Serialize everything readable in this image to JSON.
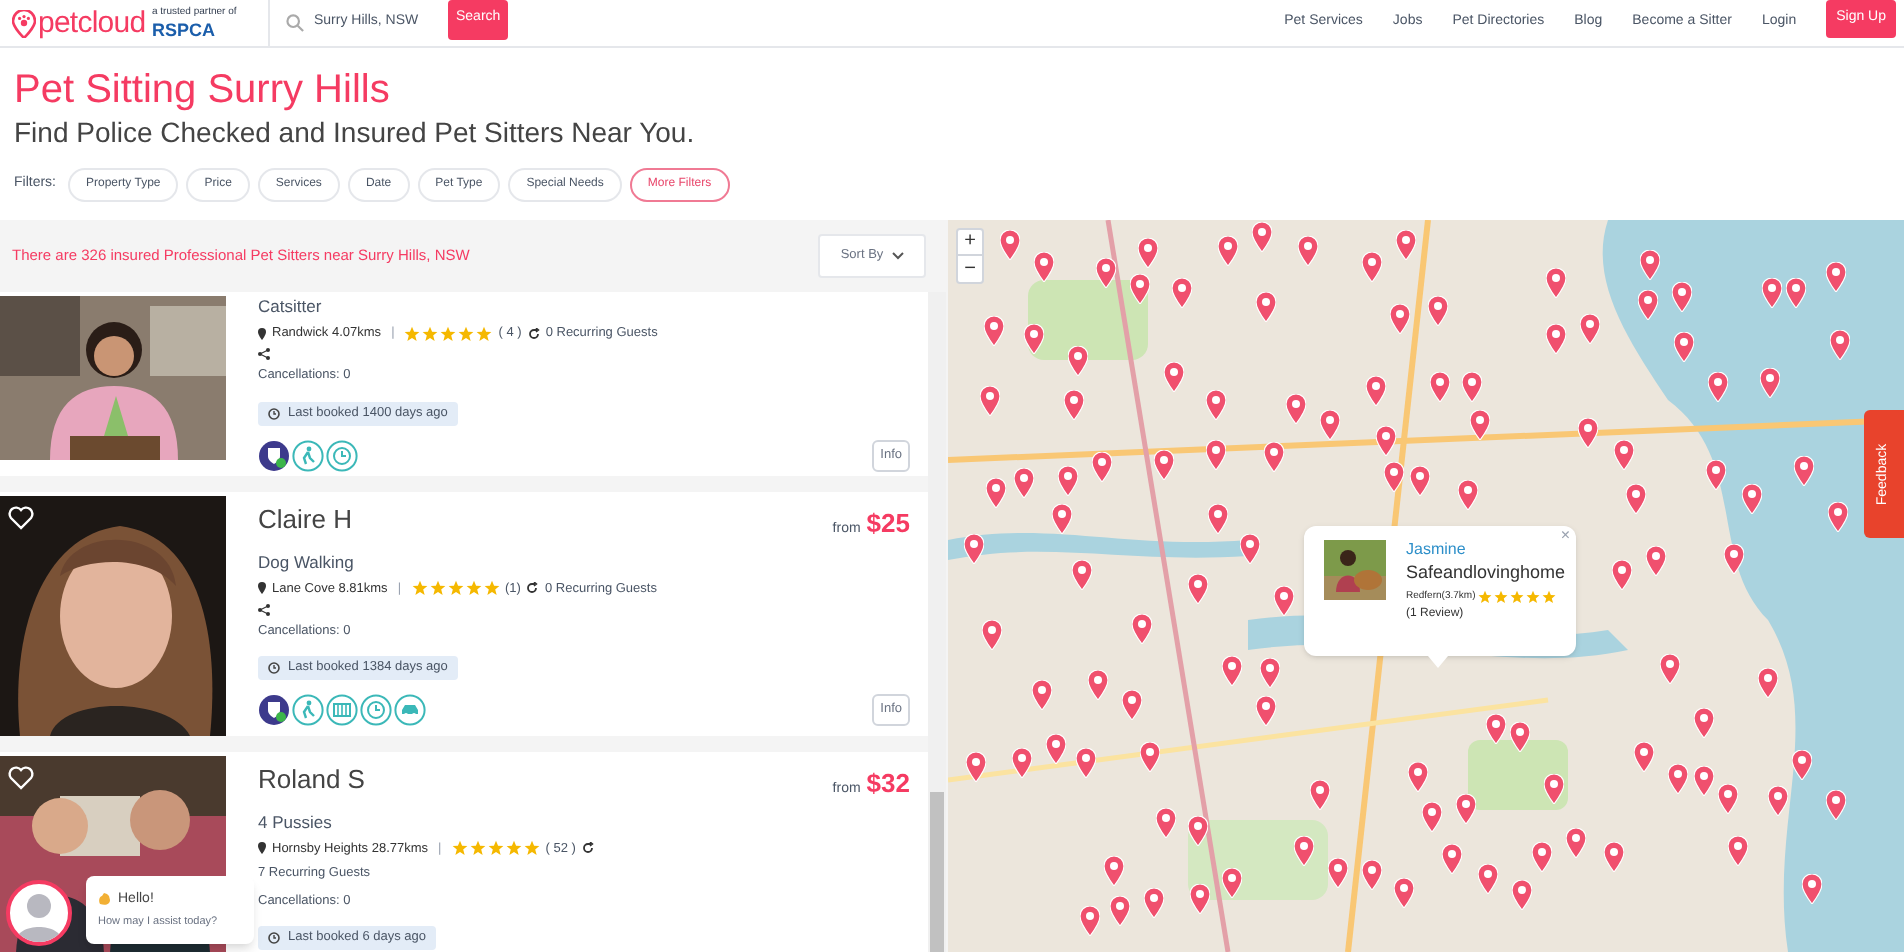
{
  "header": {
    "logo": "petcloud",
    "partner_text": "a trusted partner of",
    "partner": "RSPCA",
    "search": {
      "value": "Surry Hills, NSW"
    },
    "search_button": "Search",
    "nav": [
      "Pet Services",
      "Jobs",
      "Pet Directories",
      "Blog",
      "Become a Sitter",
      "Login"
    ],
    "sign_up": "Sign Up"
  },
  "title": "Pet Sitting Surry Hills",
  "subtitle": "Find Police Checked and Insured Pet Sitters Near You.",
  "filters": {
    "label": "Filters:",
    "items": [
      {
        "label": "Property Type",
        "highlighted": false
      },
      {
        "label": "Price",
        "highlighted": false
      },
      {
        "label": "Services",
        "highlighted": false
      },
      {
        "label": "Date",
        "highlighted": false
      },
      {
        "label": "Pet Type",
        "highlighted": false
      },
      {
        "label": "Special Needs",
        "highlighted": false
      },
      {
        "label": "More Filters",
        "highlighted": true
      }
    ]
  },
  "results": {
    "summary": "There are 326 insured Professional Pet Sitters near Surry Hills, NSW",
    "sort": "Sort By"
  },
  "sitters": [
    {
      "service": "Catsitter",
      "location": "Randwick 4.07kms",
      "separator": "|",
      "stars": 5,
      "reviews": "( 4 )",
      "recurring": "0 Recurring Guests",
      "cancellations": "Cancellations: 0",
      "last_booked": "Last booked 1400 days ago",
      "badges": [
        {
          "kind": "police_check"
        },
        {
          "kind": "walking"
        },
        {
          "kind": "clock"
        }
      ],
      "info": "Info"
    },
    {
      "name": "Claire H",
      "favorite": false,
      "price_from": "from",
      "price": "$25",
      "service": "Dog Walking",
      "location": "Lane Cove 8.81kms",
      "separator": "|",
      "stars": 5,
      "reviews": "(1)",
      "recurring": "0 Recurring Guests",
      "cancellations": "Cancellations: 0",
      "last_booked": "Last booked 1384 days ago",
      "badges": [
        {
          "kind": "police_check"
        },
        {
          "kind": "walking"
        },
        {
          "kind": "kennel"
        },
        {
          "kind": "clock"
        },
        {
          "kind": "car"
        }
      ],
      "info": "Info"
    },
    {
      "name": "Roland S",
      "favorite": false,
      "price_from": "from",
      "price": "$32",
      "service": "4 Pussies",
      "location": "Hornsby Heights 28.77kms",
      "separator": "|",
      "stars": 5,
      "reviews": "( 52 )",
      "recurring": "7 Recurring Guests",
      "cancellations": "Cancellations: 0",
      "last_booked": "Last booked 6 days ago"
    }
  ],
  "map": {
    "zoom_in": "+",
    "zoom_out": "−",
    "popup": {
      "name": "Jasmine",
      "title": "Safeandlovinghome",
      "location": "Redfern(3.7km)",
      "stars": 5,
      "reviews": "(1 Review)",
      "close": "×"
    }
  },
  "feedback": "Feedback",
  "chat": {
    "greeting": "Hello!",
    "prompt": "How may I assist today?"
  }
}
